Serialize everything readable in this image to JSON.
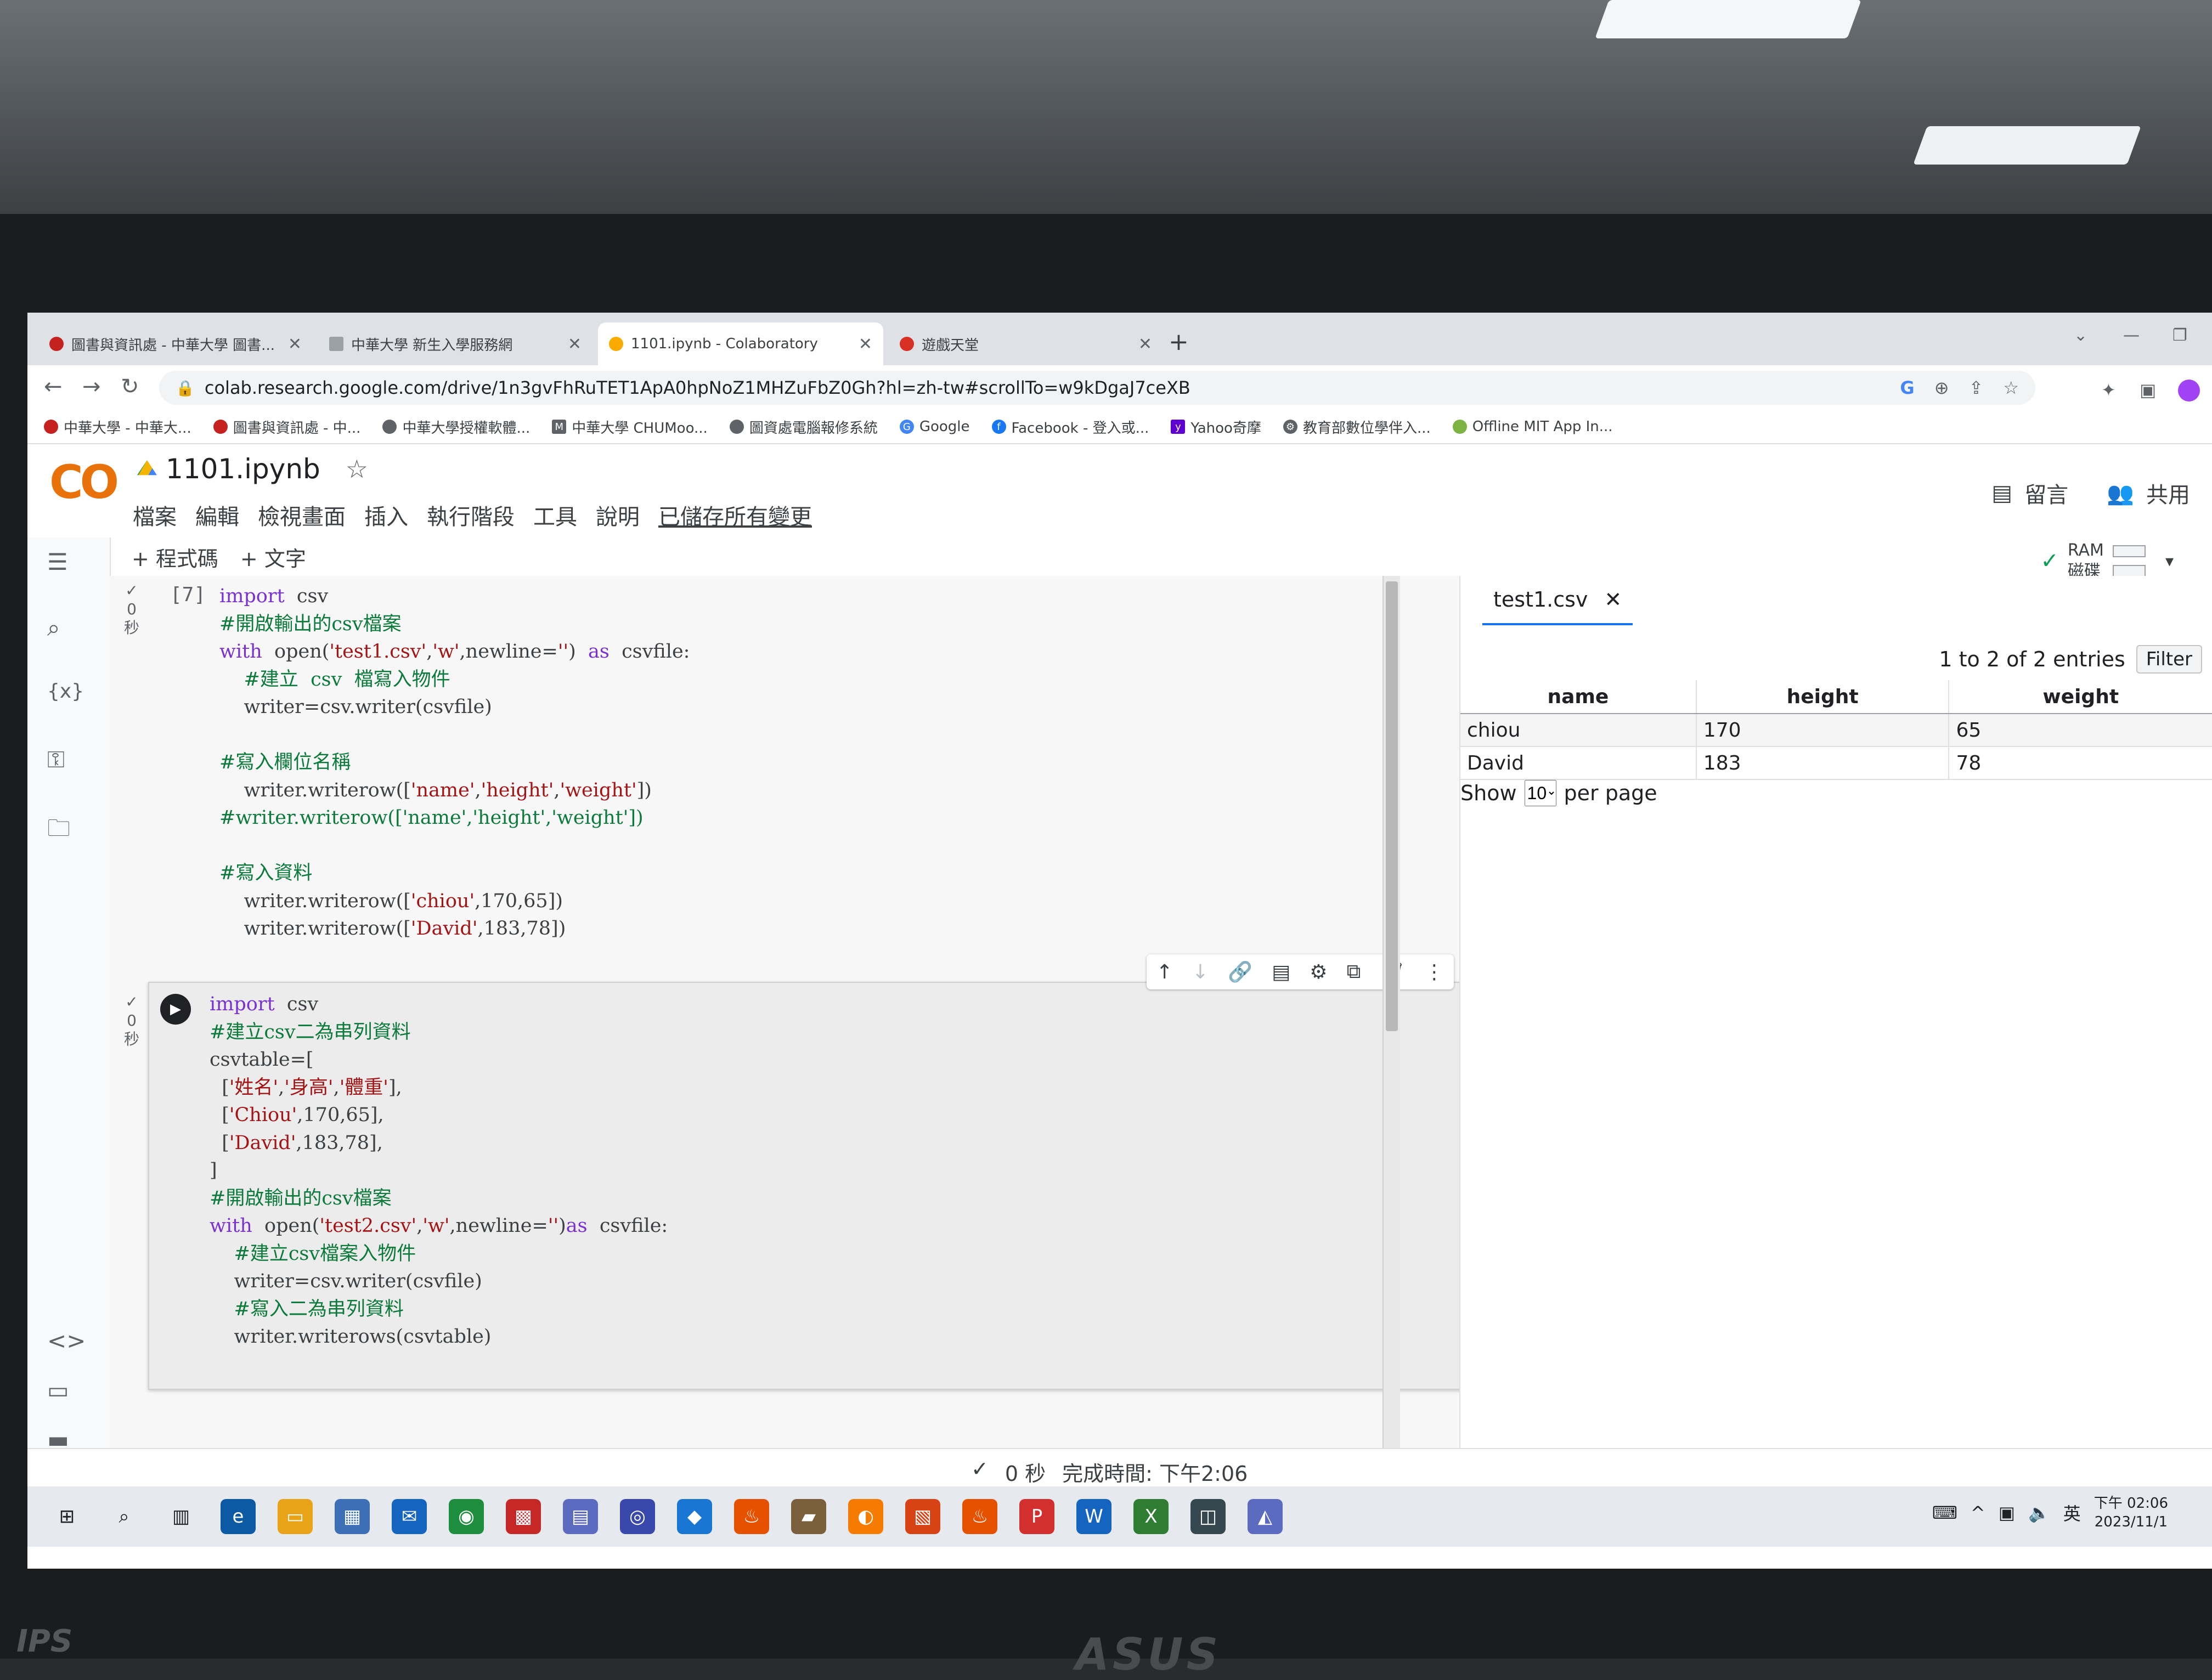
{
  "browser": {
    "tabs": [
      {
        "title": "圖書與資訊處 - 中華大學 圖書...",
        "color": "#c5221f"
      },
      {
        "title": "中華大學 新生入學服務網",
        "color": "#9aa0a6"
      },
      {
        "title": "1101.ipynb - Colaboratory",
        "color": "#f9ab00"
      },
      {
        "title": "遊戲天堂",
        "color": "#d93025"
      }
    ],
    "new_tab": "+",
    "url": "colab.research.google.com/drive/1n3gvFhRuTET1ApA0hpNoZ1MHZuFbZ0Gh?hl=zh-tw#scrollTo=w9kDgaJ7ceXB",
    "bookmarks": [
      "中華大學 - 中華大...",
      "圖書與資訊處 - 中...",
      "中華大學授權軟體...",
      "中華大學 CHUMoo...",
      "圖資處電腦報修系統",
      "Google",
      "Facebook - 登入或...",
      "Yahoo奇摩",
      "教育部數位學伴入...",
      "Offline MIT App In..."
    ]
  },
  "colab": {
    "logo": "CO",
    "notebook_title": "1101.ipynb",
    "menu": [
      "檔案",
      "編輯",
      "檢視畫面",
      "插入",
      "執行階段",
      "工具",
      "說明"
    ],
    "saved_status": "已儲存所有變更",
    "comment_label": "留言",
    "share_label": "共用",
    "add_code": "+ 程式碼",
    "add_text": "+ 文字",
    "ram_label": "RAM",
    "disk_label": "磁碟"
  },
  "cells": [
    {
      "exec_count": "[7]",
      "status_check": "✓",
      "status_time": "0",
      "status_unit": "秒",
      "lines": [
        "import  csv",
        "#開啟輸出的csv檔案",
        "with  open('test1.csv','w',newline='')  as  csvfile:",
        "    #建立  csv  檔寫入物件",
        "    writer=csv.writer(csvfile)",
        "",
        "#寫入欄位名稱",
        "    writer.writerow(['name','height','weight'])",
        "#writer.writerow(['name','height','weight'])",
        "",
        "#寫入資料",
        "    writer.writerow(['chiou',170,65])",
        "    writer.writerow(['David',183,78])"
      ]
    },
    {
      "status_check": "✓",
      "status_time": "0",
      "status_unit": "秒",
      "lines": [
        "import  csv",
        "#建立csv二為串列資料",
        "csvtable=[",
        "  ['姓名','身高','體重'],",
        "  ['Chiou',170,65],",
        "  ['David',183,78],",
        "]",
        "#開啟輸出的csv檔案",
        "with  open('test2.csv','w',newline='')as  csvfile:",
        "    #建立csv檔案入物件",
        "    writer=csv.writer(csvfile)",
        "    #寫入二為串列資料",
        "    writer.writerows(csvtable)"
      ]
    }
  ],
  "file_viewer": {
    "tab_title": "test1.csv",
    "entries_text": "1 to 2 of 2 entries",
    "filter_label": "Filter",
    "columns": [
      "name",
      "height",
      "weight"
    ],
    "rows": [
      [
        "chiou",
        "170",
        "65"
      ],
      [
        "David",
        "183",
        "78"
      ]
    ],
    "show_label": "Show",
    "per_page_value": "10",
    "per_page_label": "per page"
  },
  "statusbar": {
    "check": "✓",
    "elapsed": "0 秒",
    "completed": "完成時間: 下午2:06"
  },
  "taskbar": {
    "ime": "英",
    "time": "下午 02:06",
    "date": "2023/11/1"
  },
  "monitor": {
    "brand": "ASUS",
    "badge": "IPS"
  }
}
